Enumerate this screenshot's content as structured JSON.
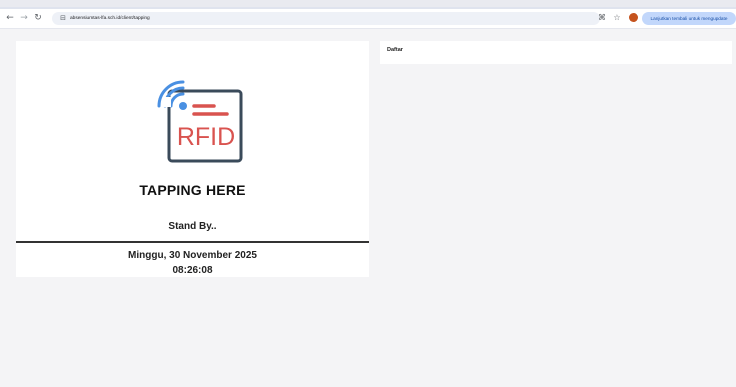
{
  "browser": {
    "url": "absensiumtas-lfa.sch.id/client/tapping",
    "update_button_label": "Lanjutkan tembali untuk mengupdate"
  },
  "icons": {
    "back": "back-arrow-icon",
    "forward": "forward-arrow-icon",
    "reload": "reload-icon",
    "site_info": "site-info-icon",
    "translate": "translate-icon",
    "bookmark": "star-icon"
  },
  "tap_panel": {
    "logo_text": "RFID",
    "title": "TAPPING HERE",
    "status": "Stand By..",
    "date": "Minggu, 30 November 2025",
    "time": "08:26:08"
  },
  "side_panel": {
    "title": "Daftar"
  },
  "colors": {
    "rfid_red": "#d9534f",
    "rfid_blue": "#4a90e2",
    "rfid_dark": "#3a4a5a",
    "page_bg": "#f4f4f6"
  }
}
